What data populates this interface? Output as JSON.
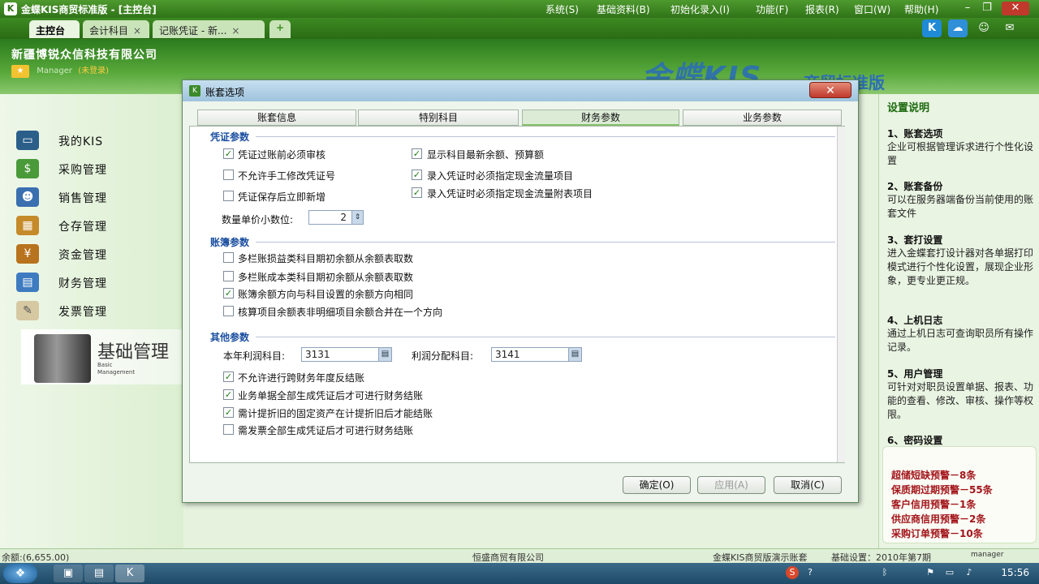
{
  "app": {
    "title": "金蝶KIS商贸标准版 - [主控台]",
    "menu": [
      "系统(S)",
      "基础资料(B)",
      "初始化录入(I)",
      "功能(F)",
      "报表(R)",
      "窗口(W)",
      "帮助(H)"
    ]
  },
  "tabs": [
    {
      "label": "主控台"
    },
    {
      "label": "会计科目"
    },
    {
      "label": "记账凭证 - 新..."
    }
  ],
  "header": {
    "company": "新疆博锐众信科技有限公司",
    "user": "Manager",
    "login_status": "(未登录)",
    "brand": "金蝶KIS",
    "brand_sub": "商贸标准版"
  },
  "nav": [
    {
      "label": "我的KIS"
    },
    {
      "label": "采购管理"
    },
    {
      "label": "销售管理"
    },
    {
      "label": "仓存管理"
    },
    {
      "label": "资金管理"
    },
    {
      "label": "财务管理"
    },
    {
      "label": "发票管理"
    }
  ],
  "basic": {
    "title": "基础管理",
    "subtitle": "Basic Management"
  },
  "dialog": {
    "title": "账套选项",
    "tabs": [
      "账套信息",
      "特别科目",
      "财务参数",
      "业务参数"
    ],
    "selected_tab": "财务参数",
    "voucher": {
      "title": "凭证参数",
      "options": [
        {
          "label": "凭证过账前必须审核",
          "checked": true
        },
        {
          "label": "不允许手工修改凭证号",
          "checked": false
        },
        {
          "label": "凭证保存后立即新增",
          "checked": false
        },
        {
          "label": "显示科目最新余额、预算额",
          "checked": true
        },
        {
          "label": "录入凭证时必须指定现金流量项目",
          "checked": true
        },
        {
          "label": "录入凭证时必须指定现金流量附表项目",
          "checked": true
        }
      ],
      "decimal_label": "数量单价小数位:",
      "decimal_value": "2"
    },
    "ledger": {
      "title": "账簿参数",
      "options": [
        {
          "label": "多栏账损益类科目期初余额从余额表取数",
          "checked": false
        },
        {
          "label": "多栏账成本类科目期初余额从余额表取数",
          "checked": false
        },
        {
          "label": "账簿余额方向与科目设置的余额方向相同",
          "checked": true
        },
        {
          "label": "核算项目余额表非明细项目余额合并在一个方向",
          "checked": false
        }
      ]
    },
    "other": {
      "title": "其他参数",
      "profit_label": "本年利润科目:",
      "profit_value": "3131",
      "distribution_label": "利润分配科目:",
      "distribution_value": "3141",
      "options": [
        {
          "label": "不允许进行跨财务年度反结账",
          "checked": true
        },
        {
          "label": "业务单据全部生成凭证后才可进行财务结账",
          "checked": true
        },
        {
          "label": "需计提折旧的固定资产在计提折旧后才能结账",
          "checked": true
        },
        {
          "label": "需发票全部生成凭证后才可进行财务结账",
          "checked": false
        }
      ]
    },
    "buttons": {
      "ok": "确定(O)",
      "apply": "应用(A)",
      "cancel": "取消(C)"
    }
  },
  "help": {
    "title": "设置说明",
    "items": [
      {
        "heading": "1、账套选项",
        "text": "企业可根据管理诉求进行个性化设置"
      },
      {
        "heading": "2、账套备份",
        "text": "可以在服务器端备份当前使用的账套文件"
      },
      {
        "heading": "3、套打设置",
        "text": "进入金蝶套打设计器对各单据打印模式进行个性化设置，展现企业形象，更专业更正规。"
      },
      {
        "heading": "4、上机日志",
        "text": "通过上机日志可查询职员所有操作记录。"
      },
      {
        "heading": "5、用户管理",
        "text": "可针对对职员设置单据、报表、功能的查看、修改、审核、操作等权限。"
      },
      {
        "heading": "6、密码设置",
        "text": ""
      }
    ],
    "alerts": [
      "超储短缺预警－8条",
      "保质期过期预警－55条",
      "客户信用预警－1条",
      "供应商信用预警－2条",
      "采购订单预警－10条"
    ]
  },
  "status": {
    "left": "余额:(6,655.00)",
    "company": "恒盛商贸有限公司",
    "edition": "金蝶KIS商贸版演示账套",
    "period": "基础设置：2010年第7期",
    "user": "manager"
  },
  "taskbar": {
    "clock": "15:56"
  }
}
